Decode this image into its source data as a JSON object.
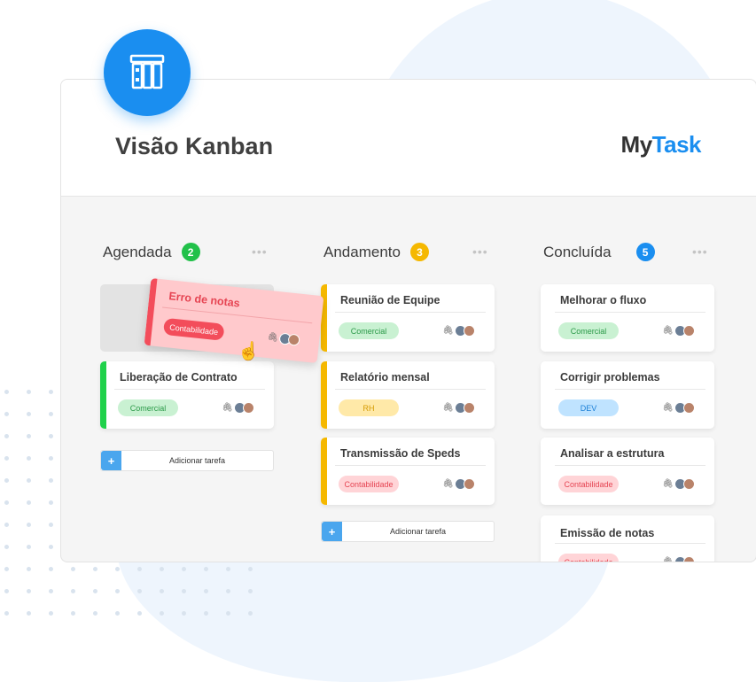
{
  "header": {
    "title": "Visão Kanban",
    "brand_part1": "My",
    "brand_part2": "Task"
  },
  "add_task_label": "Adicionar tarefa",
  "columns": [
    {
      "name": "Agendada",
      "count": "2",
      "count_color": "#22c14a",
      "tasks": [
        {
          "name": "Liberação de Contrato",
          "tag": "Comercial",
          "bar": "#1fd14a"
        }
      ]
    },
    {
      "name": "Andamento",
      "count": "3",
      "count_color": "#f5b800",
      "tasks": [
        {
          "name": "Reunião de Equipe",
          "tag": "Comercial",
          "bar": "#f5b800"
        },
        {
          "name": "Relatório mensal",
          "tag": "RH",
          "bar": "#f5b800"
        },
        {
          "name": "Transmissão de Speds",
          "tag": "Contabilidade",
          "bar": "#f5b800"
        }
      ]
    },
    {
      "name": "Concluída",
      "count": "5",
      "count_color": "#1a8ef0",
      "tasks": [
        {
          "name": "Melhorar o fluxo",
          "tag": "Comercial"
        },
        {
          "name": "Corrigir problemas",
          "tag": "DEV"
        },
        {
          "name": "Analisar a estrutura",
          "tag": "Contabilidade"
        },
        {
          "name": "Emissão de notas",
          "tag": "Contabilidade"
        }
      ]
    }
  ],
  "dragged_task": {
    "name": "Erro de notas",
    "tag": "Contabilidade"
  },
  "colors": {
    "accent": "#1a8ef0",
    "comercial_bg": "#c9f1d2",
    "comercial_fg": "#2c9a49",
    "rh_bg": "#ffe9a8",
    "rh_fg": "#d59a00",
    "contab_bg": "#ffd4d7",
    "contab_fg": "#e64553",
    "dev_bg": "#bfe3ff",
    "dev_fg": "#1a7fd6"
  },
  "icons": {
    "logo": "kanban-board-icon",
    "attachment": "paperclip-icon",
    "cursor": "hand-cursor-icon"
  }
}
